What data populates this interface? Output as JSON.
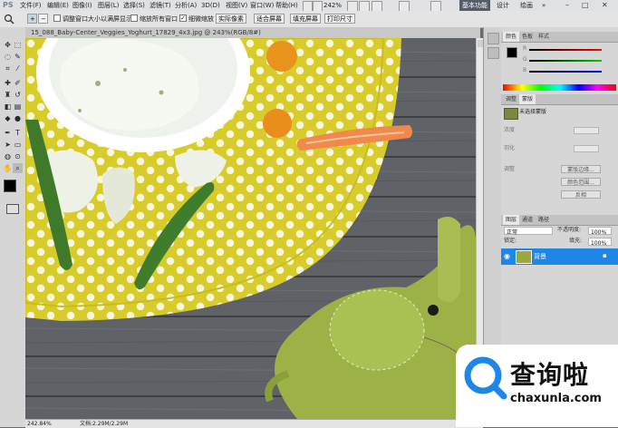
{
  "app": {
    "logo": "PS",
    "menus": [
      "文件(F)",
      "编辑(E)",
      "图像(I)",
      "图层(L)",
      "选择(S)",
      "滤镜(T)",
      "分析(A)",
      "3D(D)",
      "视图(V)",
      "窗口(W)",
      "帮助(H)"
    ],
    "zoom": "242%",
    "workspace_active": "基本功能",
    "workspaces": [
      "设计",
      "绘画",
      "»"
    ],
    "window_buttons": [
      "–",
      "□",
      "✕"
    ]
  },
  "options_bar": {
    "resize_windows": "调整窗口大小以满屏显示",
    "zoom_all": "缩放所有窗口",
    "scrubby_zoom": "细微缩放",
    "actual_pixels": "实际像素",
    "fit_screen": "适合屏幕",
    "fill_screen": "填充屏幕",
    "print_size": "打印尺寸",
    "checkmark": "✓"
  },
  "document": {
    "tab_title": "15_088_Baby-Center_Veggies_Yoghurt_17829_4x3.jpg @ 243%(RGB/8#)",
    "status_zoom": "242.84%",
    "status_doc": "文档:2.29M/2.29M"
  },
  "panels": {
    "color_tabs": [
      "颜色",
      "色板",
      "样式"
    ],
    "slider_labels": [
      "R",
      "G",
      "B"
    ],
    "adjust_tabs": [
      "调整",
      "蒙版"
    ],
    "mask_label": "未选择蒙版",
    "density_label": "浓度",
    "feather_label": "羽化",
    "refine_label": "调整",
    "refine_buttons": [
      "蒙版边缘...",
      "颜色范围...",
      "反相"
    ],
    "layers_tabs": [
      "图层",
      "通道",
      "路径"
    ],
    "blend_mode": "正常",
    "opacity_label": "不透明度:",
    "opacity_value": "100%",
    "lock_label": "锁定:",
    "fill_label": "填充:",
    "fill_value": "100%",
    "layer_name": "背景"
  },
  "watermark": {
    "brand": "查询啦",
    "domain": "chaxunla.com"
  },
  "colors": {
    "accent": "#1d86e6",
    "plate": "#d6cb2b",
    "wood": "#5d6164",
    "felt": "#9fb54a"
  }
}
